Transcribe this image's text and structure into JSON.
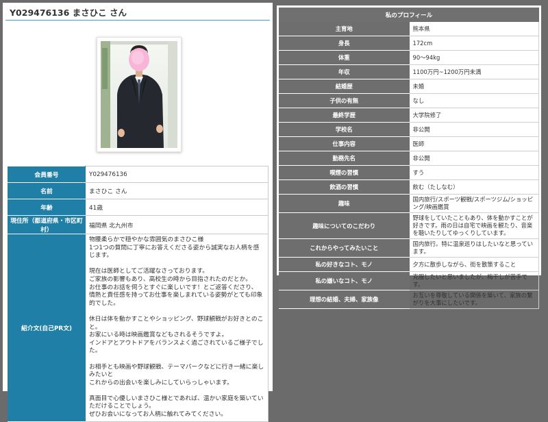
{
  "member": {
    "header_name": "Y029476136 まさひこ さん"
  },
  "basic": [
    {
      "label": "会員番号",
      "value": "Y029476136"
    },
    {
      "label": "名前",
      "value": "まさひこ さん"
    },
    {
      "label": "年齢",
      "value": "41歳"
    },
    {
      "label": "現住所（都道府県・市区町村）",
      "value": "福岡県 北九州市"
    }
  ],
  "pr": {
    "label": "紹介文(自己PR文)",
    "paragraphs": [
      "物腰柔らかで穏やかな雰囲気のまさひこ様\n1つ1つの質問に丁寧にお答えくださる姿から誠実なお人柄を感じます。",
      "現在は医師としてご活躍なさっております。\nご家族の影響もあり、高校生の時から目指されたのだとか。\nお仕事のお話を伺うとすぐに楽しいです！とご返答くださり、\n情熱と責任感を持ってお仕事を楽しまれている姿勢がとても印象的でした。",
      "休日は体を動かすことやショッピング、野球観戦がお好きとのこと。\nお家にいる時は映画鑑賞などもされるそうですよ。\nインドアとアウトドアをバランスよく過ごされているご様子でした。",
      "お相手とも映画や野球観戦、テーマパークなどに行き一緒に楽しみたいと\nこれからの出会いを楽しみにしていらっしゃいます。",
      "真面目で心優しいまさひこ様とであれば、温かい家庭を築いていただけることでしょう。\nぜひお会いになってお人柄に触れてみてください。"
    ]
  },
  "profile": {
    "title": "私のプロフィール",
    "rows": [
      {
        "label": "主育地",
        "value": "熊本県"
      },
      {
        "label": "身長",
        "value": "172cm"
      },
      {
        "label": "体重",
        "value": "90～94kg"
      },
      {
        "label": "年収",
        "value": "1100万円~1200万円未満"
      },
      {
        "label": "結婚歴",
        "value": "未婚"
      },
      {
        "label": "子供の有無",
        "value": "なし"
      },
      {
        "label": "最終学歴",
        "value": "大学院修了"
      },
      {
        "label": "学校名",
        "value": "非公開"
      },
      {
        "label": "仕事内容",
        "value": "医師"
      },
      {
        "label": "勤務先名",
        "value": "非公開"
      },
      {
        "label": "喫煙の習慣",
        "value": "すう"
      },
      {
        "label": "飲酒の習慣",
        "value": "飲む（たしなむ）"
      },
      {
        "label": "趣味",
        "value": "国内旅行/スポーツ観戦/スポーツジム/ショッピング/映画鑑賞"
      },
      {
        "label": "趣味についてのこだわり",
        "value": "野球をしていたこともあり、体を動かすことが好きです。雨の日は自宅で映画を観たり、音楽を聴いたりしてゆっくりしています。"
      },
      {
        "label": "これからやってみたいこと",
        "value": "国内旅行。特に温泉巡りはしたいなと思っています。"
      },
      {
        "label": "私の好きなコト、モノ",
        "value": "夕方に散歩しながら、街を散策すること"
      },
      {
        "label": "私の嫌いなコト、モノ",
        "value": "克服したいと思いましたが、梅干しが苦手です。"
      },
      {
        "label": "理想の結婚、夫婦、家族像",
        "value": "お互いを尊敬している関係を築いて、家族の繋がりを大事にしたいです。"
      }
    ]
  }
}
